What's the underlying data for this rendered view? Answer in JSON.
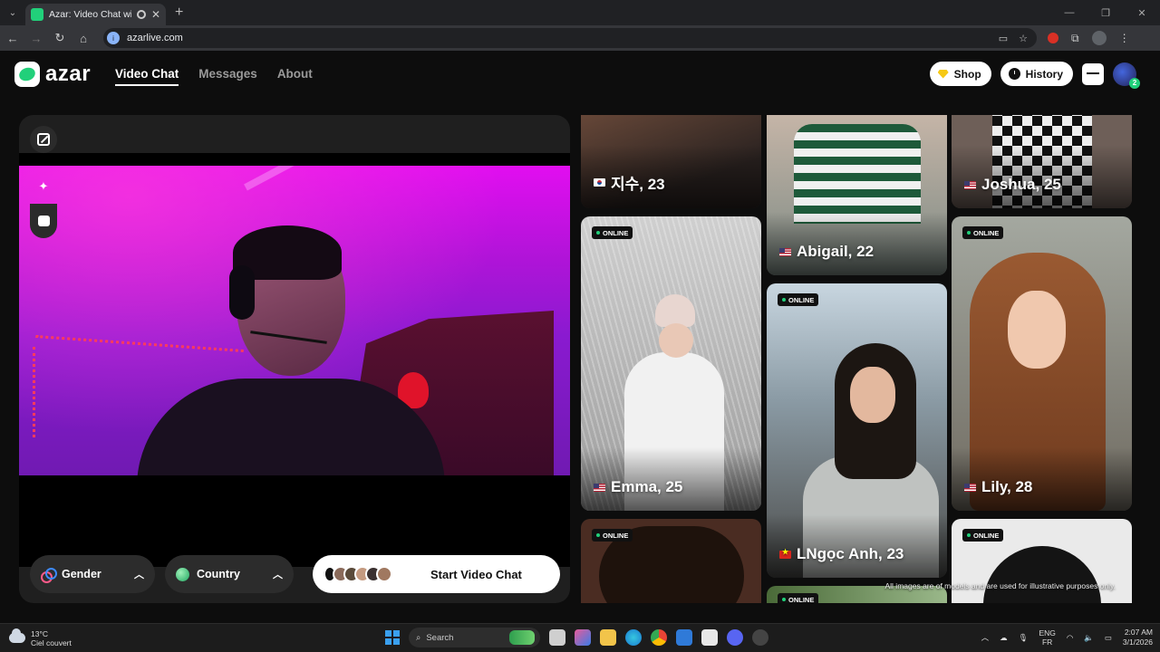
{
  "browser": {
    "tab_title": "Azar: Video Chat with New",
    "url": "azarlive.com"
  },
  "site": {
    "logo_text": "azar",
    "nav": [
      {
        "label": "Video Chat",
        "active": true
      },
      {
        "label": "Messages",
        "active": false
      },
      {
        "label": "About",
        "active": false
      }
    ],
    "shop_label": "Shop",
    "history_label": "History",
    "avatar_badge": "2"
  },
  "video_panel": {
    "gender_label": "Gender",
    "country_label": "Country",
    "start_label": "Start Video Chat"
  },
  "gallery": {
    "online_label": "ONLINE",
    "cards": [
      {
        "name": "지수, 23",
        "flag": "kr",
        "online": false
      },
      {
        "name": "Abigail, 22",
        "flag": "us",
        "online": false
      },
      {
        "name": "Joshua, 25",
        "flag": "us",
        "online": false
      },
      {
        "name": "Emma, 25",
        "flag": "us",
        "online": true
      },
      {
        "name": "LNgọc Anh, 23",
        "flag": "vn",
        "online": true
      },
      {
        "name": "Lily, 28",
        "flag": "us",
        "online": true
      },
      {
        "name": "",
        "flag": "",
        "online": true
      },
      {
        "name": "",
        "flag": "",
        "online": true
      },
      {
        "name": "",
        "flag": "",
        "online": true
      }
    ],
    "disclaimer": "All images are of models and are used for illustrative purposes only."
  },
  "taskbar": {
    "temperature": "13°C",
    "weather": "Ciel couvert",
    "search_placeholder": "Search",
    "lang_1": "ENG",
    "lang_2": "FR",
    "time": "2:07 AM",
    "date": "3/1/2026"
  },
  "colors": {
    "accent": "#21d07a",
    "background": "#0d0d0d",
    "panel": "#1f1f1f"
  }
}
